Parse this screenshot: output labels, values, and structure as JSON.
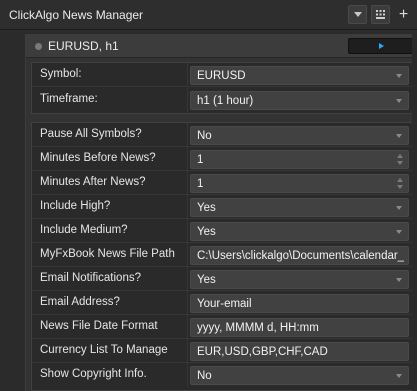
{
  "app": {
    "title": "ClickAlgo News Manager",
    "add_label": "+"
  },
  "instance": {
    "title": "EURUSD, h1"
  },
  "rows": [
    {
      "label": "Symbol:",
      "value": "EURUSD"
    },
    {
      "label": "Timeframe:",
      "value": "h1 (1 hour)"
    },
    {
      "label": "Pause All Symbols?",
      "value": "No"
    },
    {
      "label": "Minutes Before News?",
      "value": "1"
    },
    {
      "label": "Minutes After News?",
      "value": "1"
    },
    {
      "label": "Include High?",
      "value": "Yes"
    },
    {
      "label": "Include Medium?",
      "value": "Yes"
    },
    {
      "label": "MyFxBook News File Path",
      "value": "C:\\Users\\clickalgo\\Documents\\calendar_statement.csv"
    },
    {
      "label": "Email Notifications?",
      "value": "Yes"
    },
    {
      "label": "Email Address?",
      "value": "Your-email"
    },
    {
      "label": "News File Date Format",
      "value": "yyyy, MMMM d, HH:mm"
    },
    {
      "label": "Currency List To Manage",
      "value": "EUR,USD,GBP,CHF,CAD"
    },
    {
      "label": "Show Copyright Info.",
      "value": "No"
    }
  ],
  "colors": {
    "accent": "#2aa6ff",
    "background": "#2b2b2b",
    "field": "#414141"
  },
  "icons": {
    "dropdown": "chevron-down-icon",
    "keyboard": "keyboard-icon",
    "add": "plus-icon",
    "play": "play-icon"
  }
}
